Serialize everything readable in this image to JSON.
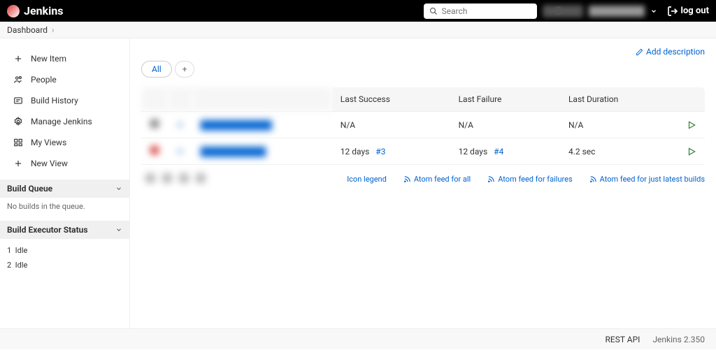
{
  "header": {
    "brand": "Jenkins",
    "search_placeholder": "Search",
    "logout": "log out"
  },
  "breadcrumbs": [
    {
      "label": "Dashboard"
    }
  ],
  "sidebar": {
    "items": [
      {
        "icon": "plus",
        "label": "New Item"
      },
      {
        "icon": "people",
        "label": "People"
      },
      {
        "icon": "history",
        "label": "Build History"
      },
      {
        "icon": "gear",
        "label": "Manage Jenkins"
      },
      {
        "icon": "views",
        "label": "My Views"
      },
      {
        "icon": "plus",
        "label": "New View"
      }
    ],
    "build_queue": {
      "title": "Build Queue",
      "empty_text": "No builds in the queue."
    },
    "executor_status": {
      "title": "Build Executor Status",
      "executors": [
        {
          "num": "1",
          "state": "Idle"
        },
        {
          "num": "2",
          "state": "Idle"
        }
      ]
    }
  },
  "main": {
    "add_description": "Add description",
    "tabs": {
      "all": "All"
    },
    "columns": {
      "status": "S",
      "weather": "W",
      "name": "Name",
      "last_success": "Last Success",
      "last_failure": "Last Failure",
      "last_duration": "Last Duration"
    },
    "jobs": [
      {
        "status": "gray",
        "last_success": "N/A",
        "last_success_build": "",
        "last_failure": "N/A",
        "last_failure_build": "",
        "last_duration": "N/A"
      },
      {
        "status": "red",
        "last_success": "12 days",
        "last_success_build": "#3",
        "last_failure": "12 days",
        "last_failure_build": "#4",
        "last_duration": "4.2 sec"
      }
    ],
    "icon_legend": "Icon legend",
    "feeds": {
      "all": "Atom feed for all",
      "failures": "Atom feed for failures",
      "latest": "Atom feed for just latest builds"
    }
  },
  "footer": {
    "rest_api": "REST API",
    "version": "Jenkins 2.350"
  }
}
